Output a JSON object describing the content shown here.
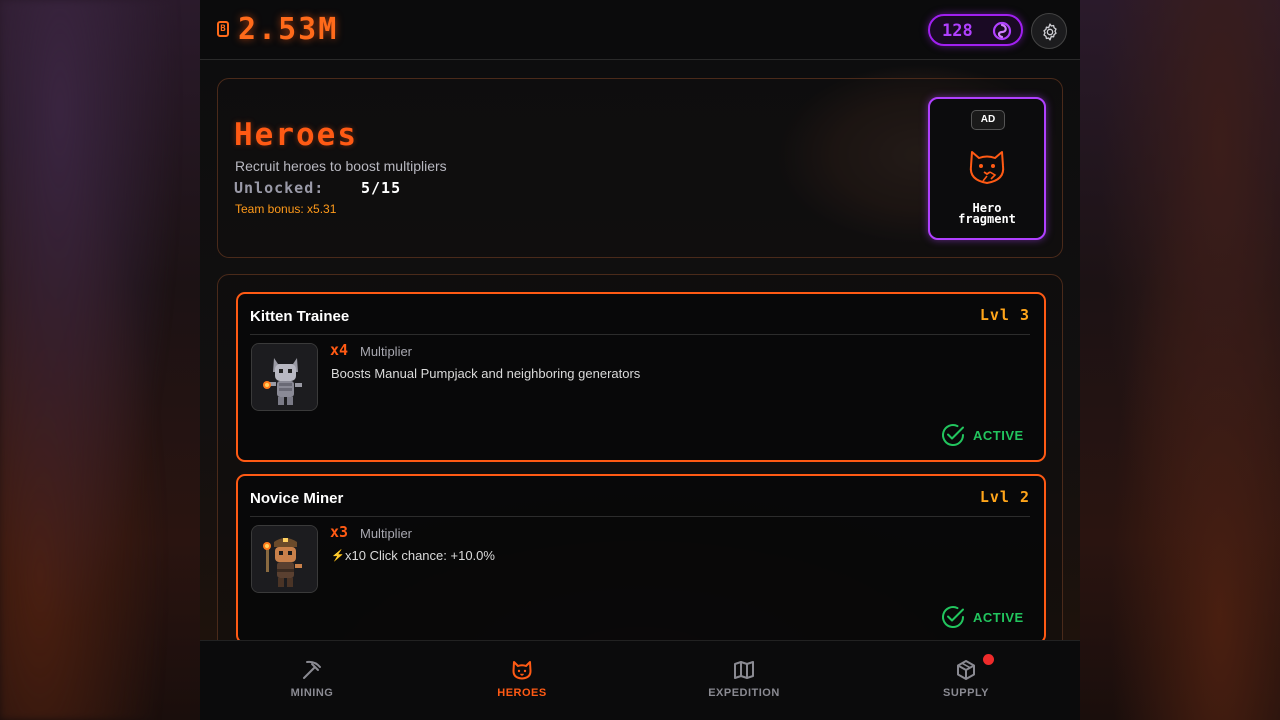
{
  "header": {
    "balance": "2.53M",
    "coin_icon_glyph": "B",
    "gem_count": "128",
    "gem_icon": "swirl-gem-icon",
    "settings_icon": "gear-icon"
  },
  "heroes_section": {
    "title": "Heroes",
    "subtitle": "Recruit heroes to boost multipliers",
    "unlocked_label": "Unlocked:",
    "unlocked_value": "5/15",
    "team_bonus": "Team bonus: x5.31",
    "ad_card": {
      "badge": "AD",
      "label_line1": "Hero",
      "label_line2": "fragment",
      "icon": "cat-face-icon"
    }
  },
  "hero_list": [
    {
      "name": "Kitten Trainee",
      "level": "Lvl 3",
      "multiplier": "x4",
      "multiplier_label": "Multiplier",
      "description": "Boosts Manual Pumpjack and neighboring generators",
      "status": "ACTIVE"
    },
    {
      "name": "Novice Miner",
      "level": "Lvl 2",
      "multiplier": "x3",
      "multiplier_label": "Multiplier",
      "description": "x10 Click chance: +10.0%",
      "status": "ACTIVE"
    }
  ],
  "nav": {
    "items": [
      {
        "label": "MINING",
        "icon": "pickaxe-icon"
      },
      {
        "label": "HEROES",
        "icon": "cat-icon"
      },
      {
        "label": "EXPEDITION",
        "icon": "map-icon"
      },
      {
        "label": "SUPPLY",
        "icon": "box-icon"
      }
    ],
    "active": "HEROES"
  },
  "colors": {
    "accent_orange": "#ff5a14",
    "accent_purple": "#b040ff",
    "level_gold": "#ffa51a",
    "active_green": "#22c55e",
    "notification_red": "#ef2b2b"
  }
}
